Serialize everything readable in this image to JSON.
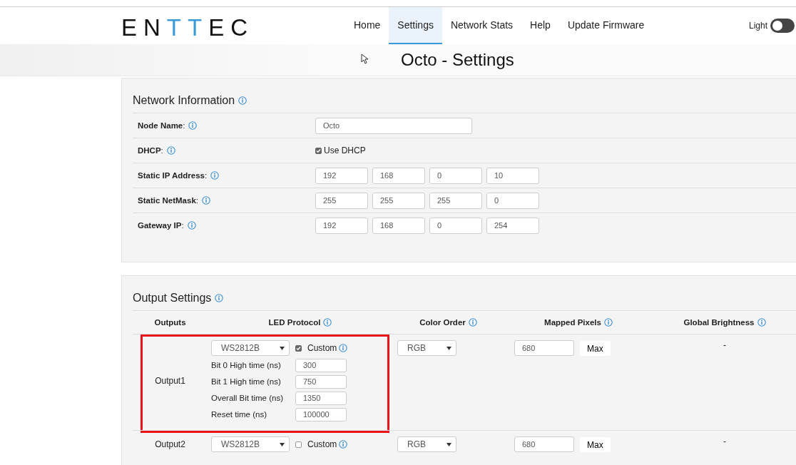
{
  "header": {
    "logo": "ENTTEC",
    "nav": [
      {
        "label": "Home",
        "selected": false
      },
      {
        "label": "Settings",
        "selected": true
      },
      {
        "label": "Network Stats",
        "selected": false
      },
      {
        "label": "Help",
        "selected": false
      },
      {
        "label": "Update Firmware",
        "selected": false
      }
    ],
    "theme_toggle": {
      "label": "Light",
      "on": false
    }
  },
  "page_title": "Octo - Settings",
  "network": {
    "title": "Network Information",
    "rows": [
      {
        "label": "**Node Name**:",
        "kind": "text",
        "value": "Octo"
      },
      {
        "label": "**DHCP**:",
        "kind": "checkbox",
        "checked": true,
        "option": "Use DHCP"
      },
      {
        "label": "**Static IP Address**:",
        "kind": "ip",
        "values": [
          "192",
          "168",
          "0",
          "10"
        ]
      },
      {
        "label": "**Static NetMask**:",
        "kind": "ip",
        "values": [
          "255",
          "255",
          "255",
          "0"
        ]
      },
      {
        "label": "**Gateway IP**:",
        "kind": "ip",
        "values": [
          "192",
          "168",
          "0",
          "254"
        ]
      }
    ]
  },
  "output": {
    "title": "Output Settings",
    "columns": [
      {
        "label": "Outputs",
        "info": false
      },
      {
        "label": "LED Protocol",
        "info": true
      },
      {
        "label": "Color Order",
        "info": true
      },
      {
        "label": "Mapped Pixels",
        "info": true
      },
      {
        "label": "Global Brightness",
        "info": true
      }
    ],
    "rows": [
      {
        "name": "Output1",
        "protocol": "WS2812B",
        "custom": true,
        "custom_label": "Custom",
        "timings": [
          {
            "label": "Bit 0 High time (ns)",
            "value": "300"
          },
          {
            "label": "Bit 1 High time (ns)",
            "value": "750"
          },
          {
            "label": "Overall Bit time (ns)",
            "value": "1350"
          },
          {
            "label": "Reset time (ns)",
            "value": "100000"
          }
        ],
        "color_order": "RGB",
        "mapped_pixels": "680",
        "max_button": "Max",
        "brightness": "-",
        "highlighted": true
      },
      {
        "name": "Output2",
        "protocol": "WS2812B",
        "custom": false,
        "custom_label": "Custom",
        "timings": [],
        "color_order": "RGB",
        "mapped_pixels": "680",
        "max_button": "Max",
        "brightness": "-",
        "highlighted": false
      }
    ]
  }
}
